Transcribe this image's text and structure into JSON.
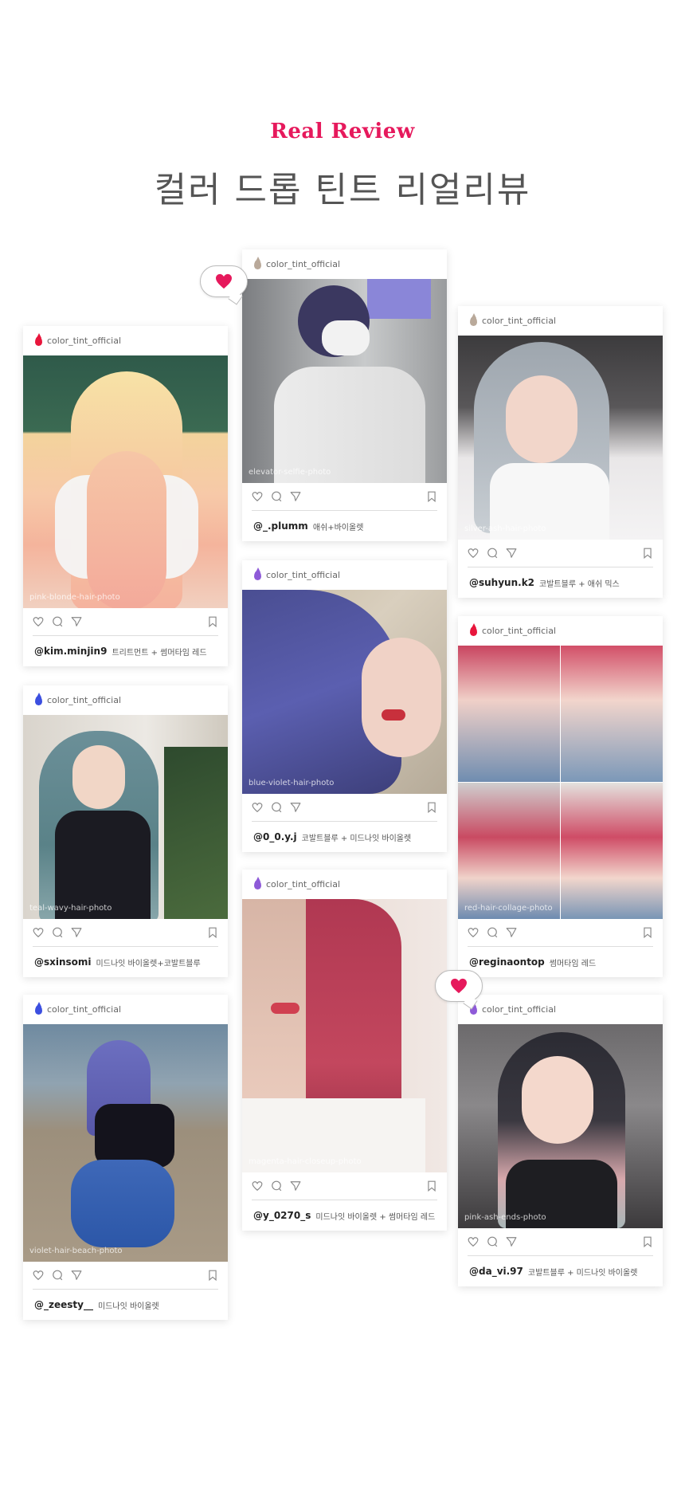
{
  "header": {
    "eyebrow": "Real Review",
    "title": "컬러 드롭 틴트 리얼리뷰"
  },
  "colors": {
    "accent": "#e6195c",
    "drop_red": "#e8163c",
    "drop_blue": "#3c4fe0",
    "drop_purple": "#8e5ad8",
    "drop_ash": "#b9a99a"
  },
  "icons": {
    "like": "heart-outline-icon",
    "comment": "comment-icon",
    "share": "send-icon",
    "save": "bookmark-icon",
    "bubble": "heart-filled-icon"
  },
  "cards": [
    {
      "username": "color_tint_official",
      "drop": "drop_red",
      "handle": "@kim.minjin9",
      "desc": "트리트먼트 + 썸머타임 레드",
      "photo": "pink-blonde-hair-photo"
    },
    {
      "username": "color_tint_official",
      "drop": "drop_blue",
      "handle": "@sxinsomi",
      "desc": "미드나잇 바이올렛+코발트블루",
      "photo": "teal-wavy-hair-photo"
    },
    {
      "username": "color_tint_official",
      "drop": "drop_blue",
      "handle": "@_zeesty__",
      "desc": "미드나잇 바이올렛",
      "photo": "violet-hair-beach-photo"
    },
    {
      "username": "color_tint_official",
      "drop": "drop_ash",
      "handle": "@_.plumm",
      "desc": "애쉬+바이올렛",
      "photo": "elevator-selfie-photo"
    },
    {
      "username": "color_tint_official",
      "drop": "drop_purple",
      "handle": "@0_0.y.j",
      "desc": "코발트블루 + 미드나잇 바이올렛",
      "photo": "blue-violet-hair-photo"
    },
    {
      "username": "color_tint_official",
      "drop": "drop_purple",
      "handle": "@y_0270_s",
      "desc": "미드나잇 바이올렛 + 썸머타임 레드",
      "photo": "magenta-hair-closeup-photo"
    },
    {
      "username": "color_tint_official",
      "drop": "drop_ash",
      "handle": "@suhyun.k2",
      "desc": "코발트블루 + 애쉬 믹스",
      "photo": "silver-ash-hair-photo"
    },
    {
      "username": "color_tint_official",
      "drop": "drop_red",
      "handle": "@reginaontop",
      "desc": "썸머타임 레드",
      "photo": "red-hair-collage-photo"
    },
    {
      "username": "color_tint_official",
      "drop": "drop_purple",
      "handle": "@da_vi.97",
      "desc": "코발트블루 + 미드나잇 바이올렛",
      "photo": "pink-ash-ends-photo"
    }
  ]
}
